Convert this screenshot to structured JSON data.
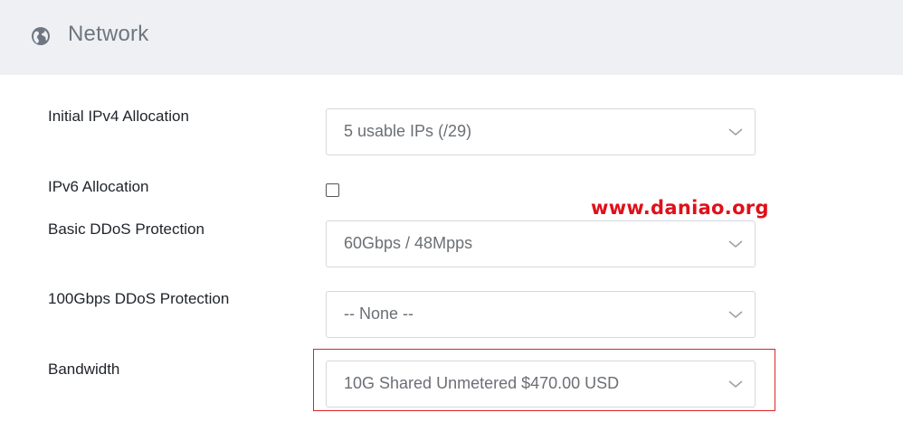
{
  "section": {
    "title": "Network",
    "icon": "globe-icon"
  },
  "fields": [
    {
      "label": "Initial IPv4 Allocation",
      "type": "select",
      "value": "5 usable IPs (/29)"
    },
    {
      "label": "IPv6 Allocation",
      "type": "checkbox",
      "checked": false
    },
    {
      "label": "Basic DDoS Protection",
      "type": "select",
      "value": "60Gbps / 48Mpps"
    },
    {
      "label": "100Gbps DDoS Protection",
      "type": "select",
      "value": "-- None --"
    },
    {
      "label": "Bandwidth",
      "type": "select",
      "value": "10G Shared Unmetered $470.00 USD",
      "highlighted": true
    }
  ],
  "watermark": "www.daniao.org",
  "colors": {
    "header_bg": "#eef0f3",
    "highlight_border": "#d9252b",
    "watermark": "#e0101a"
  }
}
